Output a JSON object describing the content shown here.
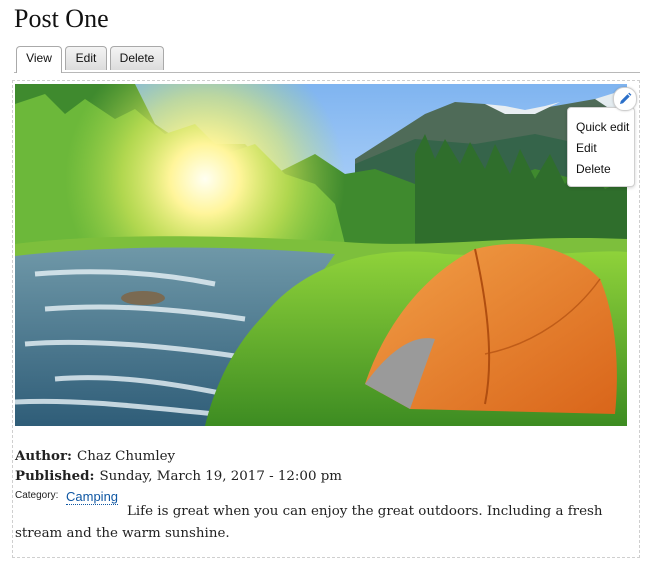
{
  "page": {
    "title": "Post One"
  },
  "tabs": [
    {
      "label": "View",
      "active": true
    },
    {
      "label": "Edit",
      "active": false
    },
    {
      "label": "Delete",
      "active": false
    }
  ],
  "contextual_menu": {
    "icon": "pencil-icon",
    "items": [
      "Quick edit",
      "Edit",
      "Delete"
    ]
  },
  "node": {
    "author_label": "Author:",
    "author_value": "Chaz Chumley",
    "published_label": "Published:",
    "published_value": "Sunday, March 19, 2017 - 12:00 pm",
    "category_label": "Category:",
    "category_value": "Camping",
    "body": "Life is great when you can enjoy the great outdoors.  Including a fresh stream and the warm sunshine."
  },
  "colors": {
    "link": "#0f57a3",
    "pencil_icon": "#2a6fc9"
  }
}
